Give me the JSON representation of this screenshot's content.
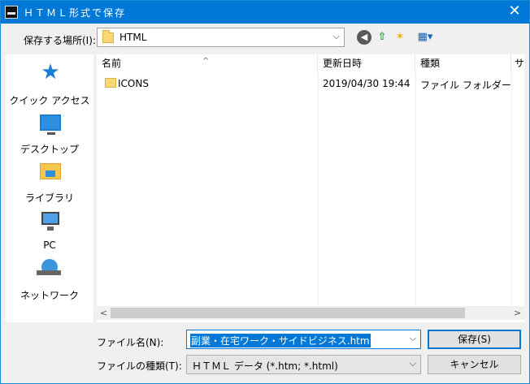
{
  "window": {
    "title": "ＨＴＭＬ形式で保存",
    "close_glyph": "✕"
  },
  "location": {
    "label": "保存する場所(I):",
    "value": "HTML",
    "arrow": "⌵"
  },
  "toolbar": {
    "back_glyph": "◀",
    "up_glyph": "⇧",
    "newfolder_glyph": "✶",
    "views_glyph": "▦▾"
  },
  "places": [
    {
      "label": "クイック アクセス",
      "icon": "quick-access-star-icon"
    },
    {
      "label": "デスクトップ",
      "icon": "desktop-icon"
    },
    {
      "label": "ライブラリ",
      "icon": "library-icon"
    },
    {
      "label": "PC",
      "icon": "pc-icon"
    },
    {
      "label": "ネットワーク",
      "icon": "network-icon"
    }
  ],
  "filelist": {
    "columns": [
      "名前",
      "更新日時",
      "種類",
      "サ"
    ],
    "sort_glyph": "^",
    "rows": [
      {
        "name": "ICONS",
        "date": "2019/04/30 19:44",
        "type": "ファイル フォルダー"
      }
    ],
    "scroll_left": "<",
    "scroll_right": ">"
  },
  "filename": {
    "label": "ファイル名(N):",
    "value": "副業・在宅ワーク・サイドビジネス.htm",
    "arrow": "⌵"
  },
  "filetype": {
    "label": "ファイルの種類(T):",
    "value": "ＨＴＭＬ データ (*.htm; *.html)",
    "arrow": "⌵"
  },
  "buttons": {
    "save": "保存(S)",
    "cancel": "キャンセル"
  },
  "colors": {
    "title_bar": "#0078d7",
    "selection": "#0078d7",
    "folder": "#f8d775"
  }
}
